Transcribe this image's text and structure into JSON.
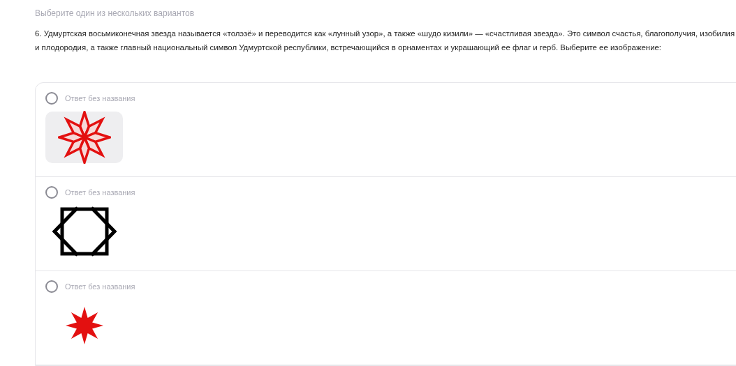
{
  "hint": "Выберите один из нескольких вариантов",
  "question": "6. Удмуртская восьмиконечная звезда называется «толэзё» и переводится как «лунный узор», а также «шудо кизили» — «счастливая звезда». Это символ счастья, благополучия, изобилия и плодородия, а также главный национальный символ Удмуртской республики, встречающийся в орнаментах и украшающий ее флаг и герб. Выберите ее изображение:",
  "options": [
    {
      "label": "Ответ без названия",
      "selected": false,
      "kind": "outline-star"
    },
    {
      "label": "Ответ без названия",
      "selected": false,
      "kind": "square-star"
    },
    {
      "label": "Ответ без названия",
      "selected": false,
      "kind": "solid-star"
    }
  ]
}
